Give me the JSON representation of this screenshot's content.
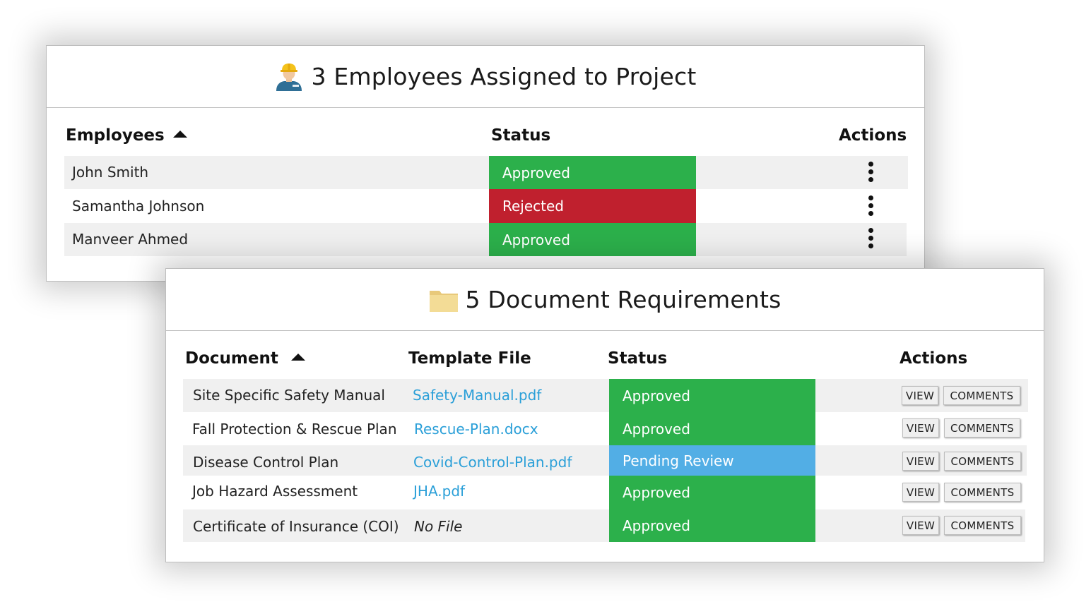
{
  "employees_card": {
    "title": "3 Employees Assigned to Project",
    "icon": "worker-hardhat-icon",
    "columns": {
      "employees": "Employees",
      "status": "Status",
      "actions": "Actions"
    },
    "rows": [
      {
        "name": "John Smith",
        "status": "Approved"
      },
      {
        "name": "Samantha Johnson",
        "status": "Rejected"
      },
      {
        "name": "Manveer Ahmed",
        "status": "Approved"
      }
    ]
  },
  "documents_card": {
    "title": "5 Document Requirements",
    "icon": "folder-icon",
    "columns": {
      "document": "Document",
      "template": "Template File",
      "status": "Status",
      "actions": "Actions"
    },
    "view_label": "VIEW",
    "comments_label": "COMMENTS",
    "rows": [
      {
        "document": "Site Specific Safety Manual",
        "template": "Safety-Manual.pdf",
        "status": "Approved"
      },
      {
        "document": "Fall Protection & Rescue Plan",
        "template": "Rescue-Plan.docx",
        "status": "Approved"
      },
      {
        "document": "Disease Control Plan",
        "template": "Covid-Control-Plan.pdf",
        "status": "Pending Review"
      },
      {
        "document": "Job Hazard Assessment",
        "template": "JHA.pdf",
        "status": "Approved"
      },
      {
        "document": "Certificate of Insurance (COI)",
        "template": "No File",
        "status": "Approved"
      }
    ]
  },
  "colors": {
    "approved": "#2cb04b",
    "rejected": "#c0202e",
    "pending": "#52aee5",
    "link": "#2a9fd8"
  }
}
